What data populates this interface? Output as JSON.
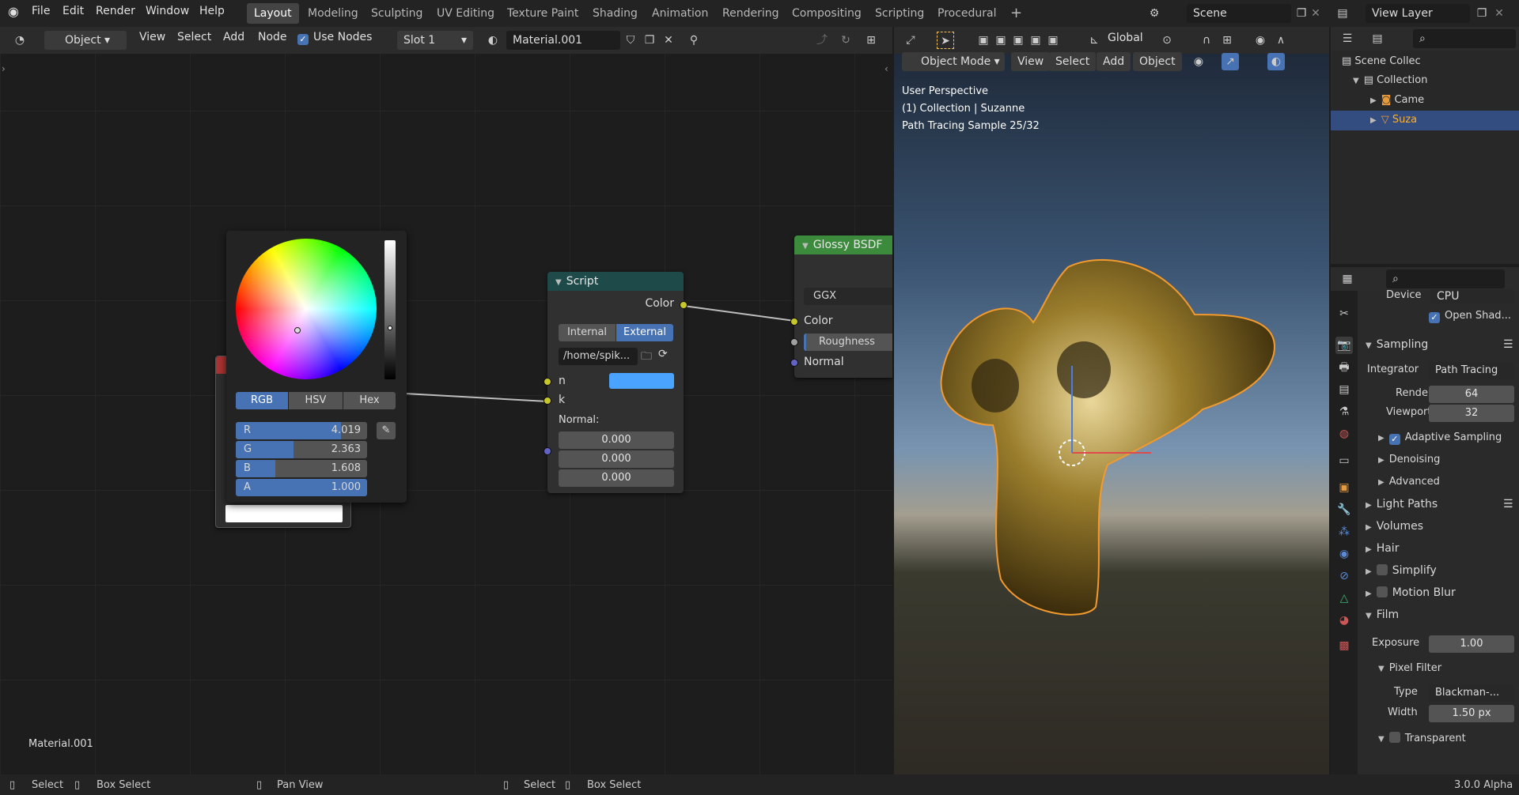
{
  "topbar": {
    "menus": [
      "File",
      "Edit",
      "Render",
      "Window",
      "Help"
    ],
    "workspaces": [
      "Layout",
      "Modeling",
      "Sculpting",
      "UV Editing",
      "Texture Paint",
      "Shading",
      "Animation",
      "Rendering",
      "Compositing",
      "Scripting",
      "Procedural"
    ],
    "active_workspace": "Layout",
    "add_tab": "+",
    "scene_name": "Scene",
    "view_layer": "View Layer"
  },
  "node_editor": {
    "object_label": "Object",
    "menus": [
      "View",
      "Select",
      "Add",
      "Node"
    ],
    "use_nodes_label": "Use Nodes",
    "slot": "Slot 1",
    "material": "Material.001",
    "footer_material": "Material.001"
  },
  "color_picker": {
    "modes": [
      "RGB",
      "HSV",
      "Hex"
    ],
    "active_mode": "RGB",
    "r_label": "R",
    "r_value": "4.019",
    "r_fill": 0.8,
    "g_label": "G",
    "g_value": "2.363",
    "g_fill": 0.44,
    "b_label": "B",
    "b_value": "1.608",
    "b_fill": 0.3,
    "a_label": "A",
    "a_value": "1.000",
    "a_fill": 1.0
  },
  "script_node": {
    "title": "Script",
    "output_color": "Color",
    "internal": "Internal",
    "external": "External",
    "path": "/home/spik...",
    "in_n": "n",
    "in_k": "k",
    "normal_label": "Normal:",
    "normal_values": [
      "0.000",
      "0.000",
      "0.000"
    ],
    "n_color": "#4aa3ff"
  },
  "glossy_node": {
    "title": "Glossy BSDF",
    "distribution": "GGX",
    "color": "Color",
    "roughness": "Roughness",
    "normal": "Normal"
  },
  "viewport": {
    "mode": "Object Mode",
    "menus": [
      "View",
      "Select",
      "Add",
      "Object"
    ],
    "transform": "Global",
    "info_line1": "User Perspective",
    "info_line2": "(1) Collection | Suzanne",
    "info_line3": "Path Tracing Sample 25/32"
  },
  "outliner": {
    "scene_collection": "Scene Collec",
    "collection": "Collection",
    "camera": "Camе",
    "suzanne": "Suza"
  },
  "properties": {
    "device_label": "Device",
    "device_value": "CPU",
    "open_shading": "Open Shad...",
    "sampling": "Sampling",
    "integrator_label": "Integrator",
    "integrator_value": "Path Tracing",
    "render_label": "Render",
    "render_value": "64",
    "viewport_label": "Viewport",
    "viewport_value": "32",
    "adaptive_sampling": "Adaptive Sampling",
    "denoising": "Denoising",
    "advanced": "Advanced",
    "light_paths": "Light Paths",
    "volumes": "Volumes",
    "hair": "Hair",
    "simplify": "Simplify",
    "motion_blur": "Motion Blur",
    "film": "Film",
    "exposure_label": "Exposure",
    "exposure_value": "1.00",
    "pixel_filter": "Pixel Filter",
    "type_label": "Type",
    "type_value": "Blackman-...",
    "width_label": "Width",
    "width_value": "1.50 px",
    "transparent": "Transparent"
  },
  "statusbar": {
    "select": "Select",
    "box_select": "Box Select",
    "pan_view": "Pan View",
    "select2": "Select",
    "box_select2": "Box Select",
    "version": "3.0.0 Alpha"
  }
}
